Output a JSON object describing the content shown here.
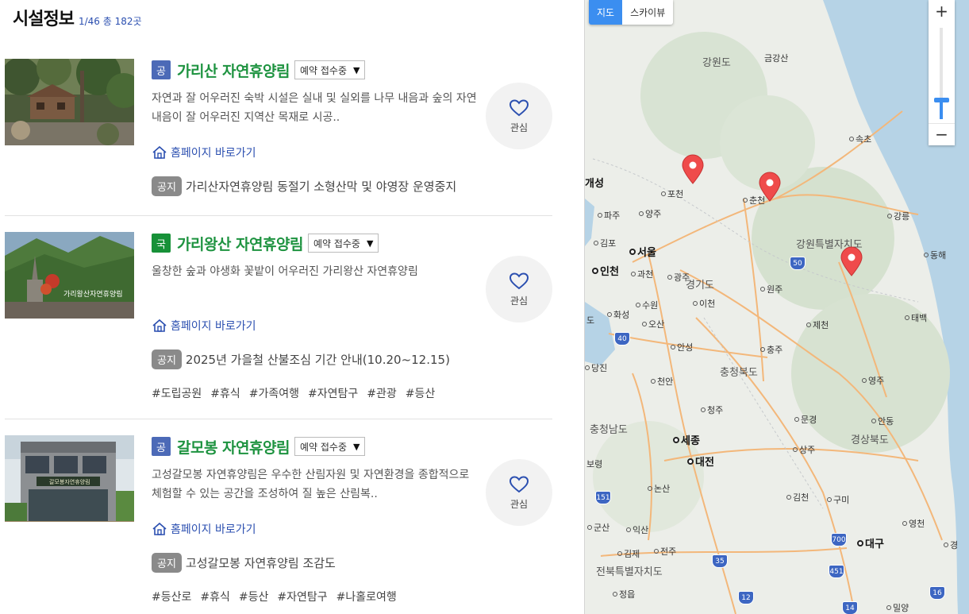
{
  "header": {
    "title": "시설정보",
    "count": "1/46 총 182곳"
  },
  "facilities": [
    {
      "type_badge": "공",
      "name": "가리산 자연휴양림",
      "status": "예약 접수중",
      "description": " 자연과 잘 어우러진 숙박 시설은 실내 및 실외를 나무 내음과 숲의 자연 내음이 잘 어우러진 지역산 목재로 시공..",
      "homepage_label": "홈페이지 바로가기",
      "notice_badge": "공지",
      "notice": "가리산자연휴양림 동절기 소형산막 및 야영장 운영중지",
      "tags": [],
      "fav_label": "관심"
    },
    {
      "type_badge": "국",
      "name": "가리왕산 자연휴양림",
      "status": "예약 접수중",
      "description": "울창한 숲과 야생화 꽃밭이 어우러진 가리왕산 자연휴양림",
      "homepage_label": "홈페이지 바로가기",
      "notice_badge": "공지",
      "notice": "2025년 가을철 산불조심 기간 안내(10.20~12.15)",
      "tags": [
        "#도립공원",
        "#휴식",
        "#가족여행",
        "#자연탐구",
        "#관광",
        "#등산"
      ],
      "fav_label": "관심"
    },
    {
      "type_badge": "공",
      "name": "갈모봉 자연휴양림",
      "status": "예약 접수중",
      "description": "고성갈모봉 자연휴양림은 우수한 산림자원 및 자연환경을 종합적으로 체험할 수 있는 공간을 조성하여 질 높은 산림복..",
      "homepage_label": "홈페이지 바로가기",
      "notice_badge": "공지",
      "notice": "고성갈모봉 자연휴양림 조감도",
      "tags": [
        "#등산로",
        "#휴식",
        "#등산",
        "#자연탐구",
        "#나홀로여행"
      ],
      "fav_label": "관심"
    }
  ],
  "thumb_signage": {
    "facility_2": "가리왕산자연휴양림",
    "facility_3": "갈모봉자연휴양림"
  },
  "map": {
    "type_map": "지도",
    "type_skyview": "스카이뷰",
    "zoom_in": "+",
    "zoom_out": "−",
    "labels": {
      "gangwondo": "강원도",
      "geumgangsan": "금강산",
      "sokcho": "속초",
      "gaeseong": "개성",
      "pocheon": "포천",
      "chuncheon": "춘천",
      "paju": "파주",
      "yangju": "양주",
      "gangneung": "강릉",
      "gangwon_special": "강원특별자치도",
      "gimpo": "김포",
      "seoul": "서울",
      "donghae": "동해",
      "incheon": "인천",
      "gwacheon": "과천",
      "gwangju_gg": "광주",
      "gyeonggido": "경기도",
      "wonju": "원주",
      "suwon": "수원",
      "icheon": "이천",
      "hwaseong": "화성",
      "osan": "오산",
      "jecheon": "제천",
      "taebaek": "태백",
      "do_edge": "도",
      "anseong": "안성",
      "chungju": "충주",
      "dangjin": "당진",
      "chungbuk": "충청북도",
      "yeongju": "영주",
      "cheonan": "천안",
      "cheongju": "청주",
      "mungyeong": "문경",
      "andong": "안동",
      "chungnam": "충청남도",
      "sejong": "세종",
      "gyeongbuk": "경상북도",
      "sangju": "상주",
      "boryeong": "보령",
      "daejeon": "대전",
      "nonsan": "논산",
      "gimcheon": "김천",
      "gumi": "구미",
      "gunsan": "군산",
      "iksan": "익산",
      "yeongcheon": "영천",
      "daegu": "대구",
      "gimje": "김제",
      "jeonju": "전주",
      "gyeong_edge": "경",
      "jeonbuk": "전북특별자치도",
      "jeongeup": "정읍",
      "miryang": "밀양"
    },
    "highways": [
      "50",
      "40",
      "151",
      "35",
      "700",
      "451",
      "12",
      "16",
      "14"
    ]
  }
}
